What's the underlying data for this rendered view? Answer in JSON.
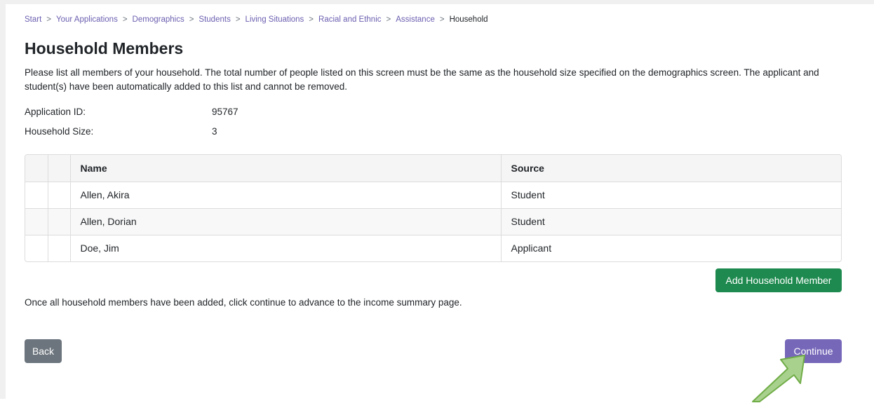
{
  "breadcrumb": {
    "items": [
      "Start",
      "Your Applications",
      "Demographics",
      "Students",
      "Living Situations",
      "Racial and Ethnic",
      "Assistance"
    ],
    "current": "Household",
    "separator": ">"
  },
  "page_title": "Household Members",
  "intro": "Please list all members of your household. The total number of people listed on this screen must be the same as the household size specified on the demographics screen. The applicant and student(s) have been automatically added to this list and cannot be removed.",
  "info": {
    "application_id_label": "Application ID:",
    "application_id": "95767",
    "household_size_label": "Household Size:",
    "household_size": "3"
  },
  "table": {
    "headers": {
      "name": "Name",
      "source": "Source"
    },
    "rows": [
      {
        "name": "Allen, Akira",
        "source": "Student"
      },
      {
        "name": "Allen, Dorian",
        "source": "Student"
      },
      {
        "name": "Doe, Jim",
        "source": "Applicant"
      }
    ]
  },
  "buttons": {
    "add_member": "Add Household Member",
    "back": "Back",
    "continue": "Continue"
  },
  "help_text": "Once all household members have been added, click continue to advance to the income summary page.",
  "annotation": {
    "icon": "arrow-icon",
    "color": "#a9d18e"
  },
  "colors": {
    "link": "#6a5fb0",
    "add_button": "#1e8a4f",
    "back_button": "#6c757d",
    "continue_button": "#7667b9"
  }
}
